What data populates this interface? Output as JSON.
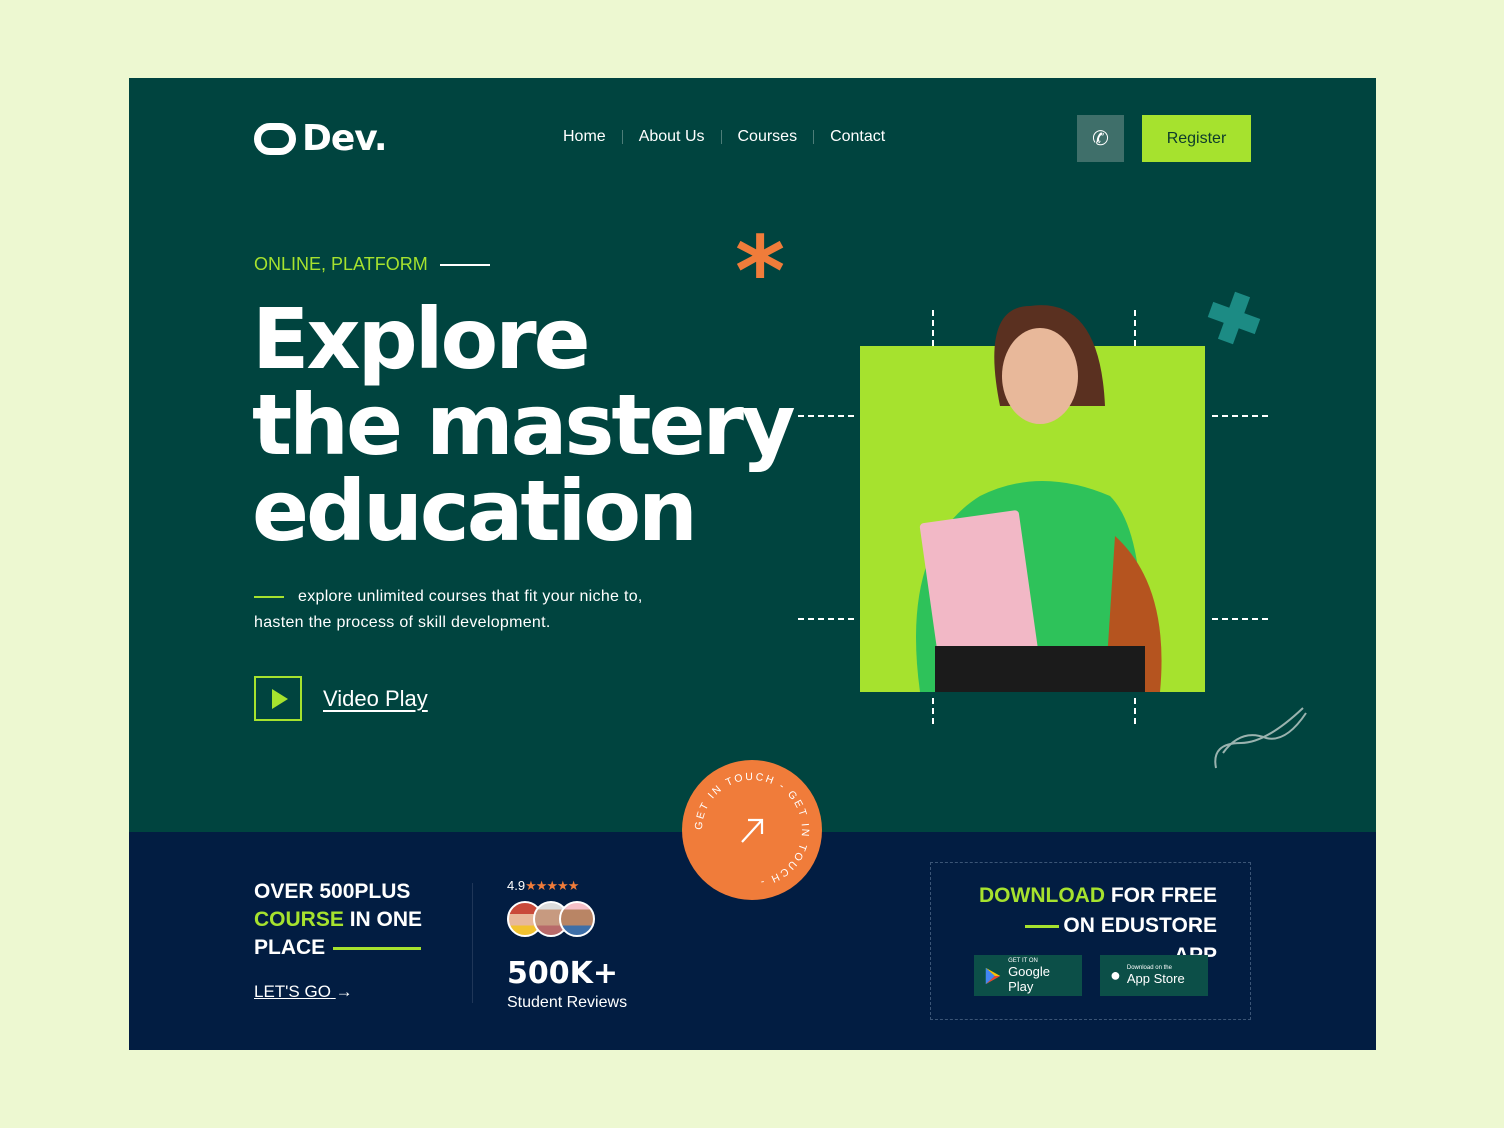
{
  "brand": {
    "name": "Dev."
  },
  "nav": {
    "items": [
      "Home",
      "About Us",
      "Courses",
      "Contact"
    ],
    "register": "Register"
  },
  "hero": {
    "eyebrow": "ONLINE, PLATFORM",
    "title_lines": [
      "Explore",
      "the mastery",
      "education"
    ],
    "description_1": "explore unlimited courses that fit your niche to,",
    "description_2": "hasten the  process of skill development.",
    "video_label": "Video Play"
  },
  "badge": {
    "circle_text": "GET IN TOUCH - GET IN TOUCH - "
  },
  "stats": {
    "line1": "OVER 500PLUS",
    "line2_highlight": "COURSE",
    "line2_rest": " IN ONE",
    "line3": "PLACE",
    "cta": "LET'S GO",
    "rating": "4.9",
    "stars": 5,
    "count": "500K+",
    "count_label": "Student Reviews"
  },
  "download": {
    "highlight": "DOWNLOAD",
    "line1_rest": " FOR FREE",
    "line2": "ON EDUSTORE APP",
    "google": {
      "small": "GET IT ON",
      "big": "Google Play"
    },
    "apple": {
      "small": "Download on the",
      "big": "App Store"
    }
  },
  "colors": {
    "primary": "#00443f",
    "accent": "#a6e22e",
    "orange": "#f07c3a",
    "navy": "#021d42"
  }
}
